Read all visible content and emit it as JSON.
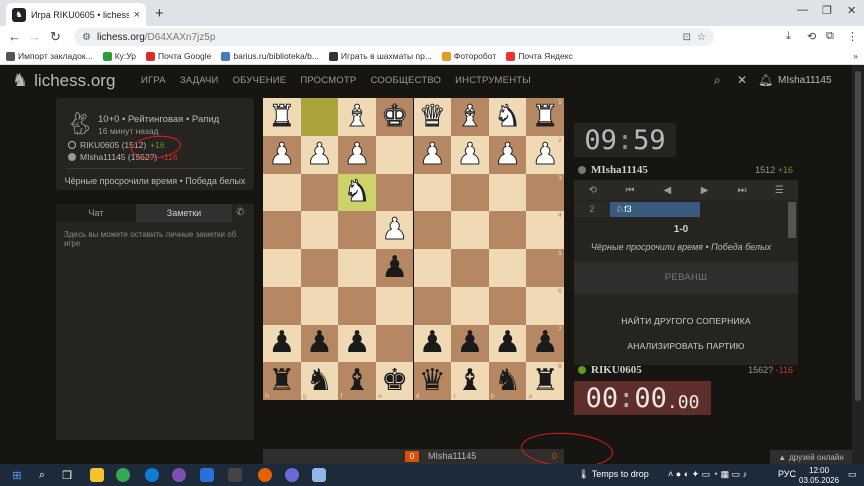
{
  "browser": {
    "tab_title": "Игра RIKU0605 • lichess.org",
    "url_host": "lichess.org",
    "url_path": "/D64XAXn7jz5p",
    "bookmarks": [
      "Импорт закладок...",
      "Ку:Ур",
      "Почта Google",
      "barius.ru/biblioteka/b...",
      "Играть в шахматы пр...",
      "Фоторобот",
      "Почта Яндекс"
    ],
    "bookmarks_more": "»"
  },
  "site": {
    "logo": "lichess.org",
    "nav": [
      "ИГРА",
      "ЗАДАЧИ",
      "ОБУЧЕНИЕ",
      "ПРОСМОТР",
      "СООБЩЕСТВО",
      "ИНСТРУМЕНТЫ"
    ],
    "username": "MIsha11145"
  },
  "game_info": {
    "title": "10+0 • Рейтинговая • Рапид",
    "time_ago": "16 минут назад",
    "white_player": "RIKU0605 (1512)",
    "white_diff": "+16",
    "black_player": "MIsha11145 (1562?)",
    "black_diff": "-116",
    "result": "Чёрные просрочили время • Победа белых"
  },
  "notes": {
    "tab_chat": "Чат",
    "tab_notes": "Заметки",
    "placeholder": "Здесь вы можете оставить личные заметки об игре"
  },
  "board": {
    "orientation": "black",
    "files_bottom": [
      "h",
      "g",
      "f",
      "e",
      "d",
      "c",
      "b",
      "a"
    ],
    "ranks_right": [
      "1",
      "2",
      "3",
      "4",
      "5",
      "6",
      "7",
      "8"
    ],
    "pieces": {
      "h1": "wR",
      "f1": "wB",
      "e1": "wK",
      "d1": "wQ",
      "c1": "wB",
      "b1": "wN",
      "a1": "wR",
      "h2": "wP",
      "g2": "wP",
      "f2": "wP",
      "d2": "wP",
      "c2": "wP",
      "b2": "wP",
      "a2": "wP",
      "f3": "wN",
      "e4": "wP",
      "e5": "bP",
      "h7": "bP",
      "g7": "bP",
      "f7": "bP",
      "d7": "bP",
      "c7": "bP",
      "b7": "bP",
      "a7": "bP",
      "h8": "bR",
      "g8": "bN",
      "f8": "bB",
      "e8": "bK",
      "d8": "bQ",
      "c8": "bB",
      "b8": "bN",
      "a8": "bR"
    },
    "last_move": [
      "g1",
      "f3"
    ]
  },
  "right_panel": {
    "top_clock": {
      "min": "09",
      "sec": "59"
    },
    "top_player": {
      "name": "MIsha11145",
      "rating": "1512",
      "diff": "+16"
    },
    "move_number": "2",
    "move": "♘f3",
    "score": "1-0",
    "status": "Чёрные просрочили время • Победа белых",
    "rematch": "РЕВАНШ",
    "new_opponent": "НАЙТИ ДРУГОГО СОПЕРНИКА",
    "analyse": "АНАЛИЗИРОВАТЬ ПАРТИЮ",
    "bottom_player": {
      "name": "RIKU0605",
      "rating": "1562?",
      "diff": "-116"
    },
    "bottom_clock": {
      "min": "00",
      "sec": "00",
      "tenth": ".0",
      "hund": "0"
    }
  },
  "bottom_bar": {
    "count": "0",
    "name": "MIsha11145",
    "zero": "0"
  },
  "friends_online": "друзей онлайн",
  "taskbar": {
    "weather": "Temps to drop",
    "lang": "РУС",
    "time": "12:00",
    "date": "03.05.2026"
  }
}
